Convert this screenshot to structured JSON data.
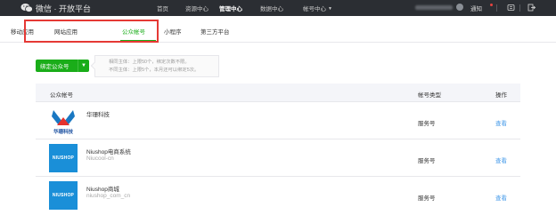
{
  "topbar": {
    "brand": "微信 · 开放平台",
    "nav": [
      {
        "label": "首页",
        "active": false,
        "caret": false
      },
      {
        "label": "资源中心",
        "active": false,
        "caret": false
      },
      {
        "label": "管理中心",
        "active": true,
        "caret": false
      },
      {
        "label": "数据中心",
        "active": false,
        "caret": false
      },
      {
        "label": "帐号中心",
        "active": false,
        "caret": true
      }
    ],
    "notice_label": "通知",
    "help_label": "|",
    "icons": [
      "wechat-logo-icon",
      "avatar",
      "notice-dot",
      "help-icon",
      "logout-icon"
    ]
  },
  "tabs": [
    {
      "label": "移动应用",
      "active": false
    },
    {
      "label": "网站应用",
      "active": false
    },
    {
      "label": "公众帐号",
      "active": true
    },
    {
      "label": "小程序",
      "active": false
    },
    {
      "label": "第三方平台",
      "active": false
    }
  ],
  "bind_button": {
    "label": "绑定公众号",
    "dropdown_icon": "chevron-down-icon"
  },
  "tips": {
    "line1": "相同主体：上限50个，绑定次数不限。",
    "line2": "不同主体：上限5个，本月还可以绑定5次。"
  },
  "table": {
    "headers": {
      "account": "公众帐号",
      "type": "帐号类型",
      "action": "操作"
    },
    "rows": [
      {
        "name": "华珊科技",
        "sub": "",
        "type": "服务号",
        "action": "查看",
        "logo_text": "华珊科技"
      },
      {
        "name": "Niushop电商系统",
        "sub": "Niucool-cn",
        "type": "服务号",
        "action": "查看",
        "logo_text": "NIUSHOP"
      },
      {
        "name": "Niushop商城",
        "sub": "niushop_com_cn",
        "type": "服务号",
        "action": "查看",
        "logo_text": "NIUSHOP"
      }
    ]
  },
  "colors": {
    "topbar_bg": "#2b2e33",
    "green": "#1aad19",
    "link_blue": "#459ae9",
    "highlight_red": "#e53935",
    "logo_blue": "#1a8fd8"
  }
}
